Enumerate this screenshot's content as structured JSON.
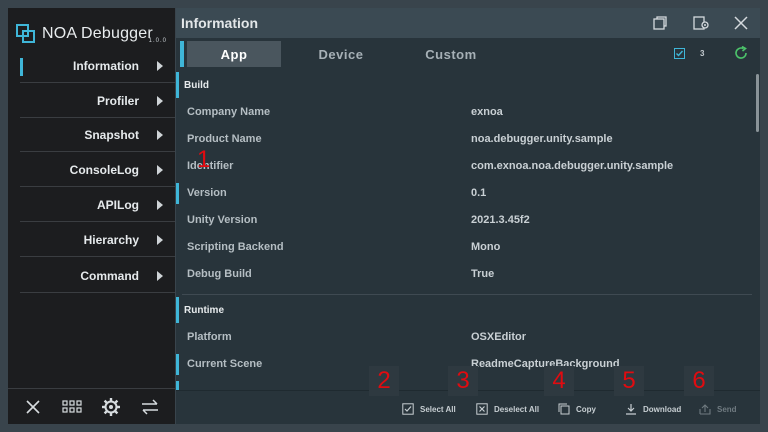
{
  "app": {
    "name": "NOA Debugger",
    "version": "1.0.0"
  },
  "sidebar": {
    "items": [
      {
        "label": "Information"
      },
      {
        "label": "Profiler"
      },
      {
        "label": "Snapshot"
      },
      {
        "label": "ConsoleLog"
      },
      {
        "label": "APILog"
      },
      {
        "label": "Hierarchy"
      },
      {
        "label": "Command"
      }
    ]
  },
  "header": {
    "title": "Information"
  },
  "tabs": [
    {
      "label": "App"
    },
    {
      "label": "Device"
    },
    {
      "label": "Custom"
    }
  ],
  "selection_count": "3",
  "sections": [
    {
      "title": "Build",
      "rows": [
        {
          "key": "Company Name",
          "value": "exnoa"
        },
        {
          "key": "Product Name",
          "value": "noa.debugger.unity.sample"
        },
        {
          "key": "Identifier",
          "value": "com.exnoa.noa.debugger.unity.sample"
        },
        {
          "key": "Version",
          "value": "0.1"
        },
        {
          "key": "Unity Version",
          "value": "2021.3.45f2"
        },
        {
          "key": "Scripting Backend",
          "value": "Mono"
        },
        {
          "key": "Debug Build",
          "value": "True"
        }
      ]
    },
    {
      "title": "Runtime",
      "rows": [
        {
          "key": "Platform",
          "value": "OSXEditor"
        },
        {
          "key": "Current Scene",
          "value": "ReadmeCaptureBackground"
        }
      ]
    }
  ],
  "toolbar": {
    "select_all": "Select All",
    "deselect_all": "Deselect All",
    "copy": "Copy",
    "download": "Download",
    "send": "Send"
  },
  "annotations": [
    "1",
    "2",
    "3",
    "4",
    "5",
    "6"
  ],
  "colors": {
    "accent": "#3fb6d8",
    "annotation": "#e00b10",
    "refresh": "#4cc36a"
  },
  "icons": {
    "footer": [
      "close-icon",
      "grid-icon",
      "gear-icon",
      "swap-icon"
    ],
    "window": [
      "window-icon",
      "settings-icon",
      "close-icon"
    ]
  }
}
